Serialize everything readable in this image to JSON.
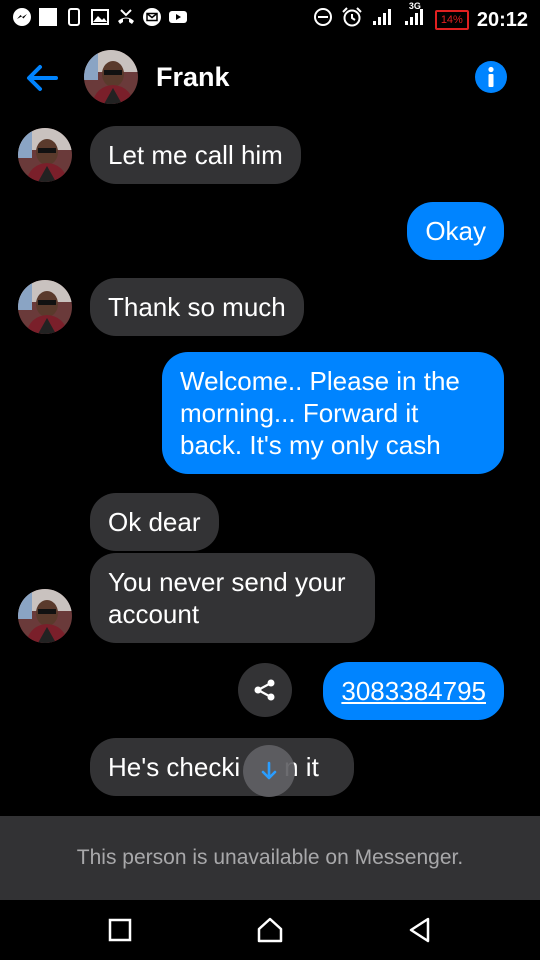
{
  "status_bar": {
    "time": "20:12",
    "battery": "14%",
    "network": "3G",
    "left_icons": [
      "messenger-icon",
      "notification-square-icon",
      "sim-icon",
      "image-icon",
      "missed-call-icon",
      "email-icon",
      "youtube-icon"
    ],
    "right_icons": [
      "do-not-disturb-icon",
      "alarm-icon",
      "signal-icon",
      "signal-3g-icon",
      "battery-icon"
    ]
  },
  "header": {
    "contact_name": "Frank",
    "back_icon": "back-arrow-icon",
    "info_icon": "info-icon"
  },
  "messages": [
    {
      "from": "Frank",
      "text": "Let me call him"
    },
    {
      "from": "me",
      "text": "Okay"
    },
    {
      "from": "Frank",
      "text": "Thank so much"
    },
    {
      "from": "me",
      "text": "Welcome.. Please in the morning... Forward it back. It's my only cash"
    },
    {
      "from": "Frank",
      "text": "Ok dear"
    },
    {
      "from": "Frank",
      "text": "You never send your account"
    },
    {
      "from": "me",
      "text": "3083384795",
      "is_link": true
    },
    {
      "from": "Frank",
      "text": "He's checking on it",
      "visible_parts": [
        "He's checki",
        "n it"
      ]
    }
  ],
  "banner": {
    "text": "This person is unavailable on Messenger."
  },
  "colors": {
    "background": "#000000",
    "incoming_bubble": "#333335",
    "outgoing_bubble": "#0084ff",
    "accent": "#0084ff",
    "banner_bg": "#323234",
    "battery_low": "#e02020"
  },
  "nav_bar": [
    "recents-square-icon",
    "home-icon",
    "back-triangle-icon"
  ]
}
